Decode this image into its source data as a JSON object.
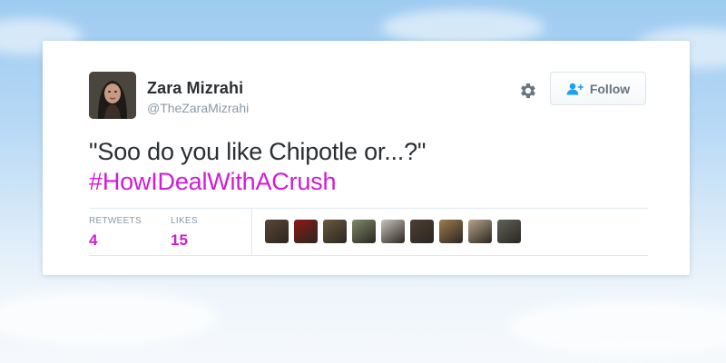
{
  "tweet": {
    "author_name": "Zara Mizrahi",
    "author_handle": "@TheZaraMizrahi",
    "text_line1": "\"Soo do you like Chipotle or...?\"",
    "hashtag": "#HowIDealWithACrush",
    "hashtag_color": "#d21bd6"
  },
  "actions": {
    "follow_label": "Follow",
    "follow_icon": "add-user-icon",
    "settings_icon": "gear-icon"
  },
  "stats": {
    "retweets_label": "RETWEETS",
    "retweets_value": "4",
    "likes_label": "LIKES",
    "likes_value": "15"
  },
  "likers": [
    {
      "color": "#5b4632"
    },
    {
      "color": "#8b1a14"
    },
    {
      "color": "#6b5a3c"
    },
    {
      "color": "#7d8a6a"
    },
    {
      "color": "#c9c4bb"
    },
    {
      "color": "#4e3f33"
    },
    {
      "color": "#a07c4e"
    },
    {
      "color": "#b7a58a"
    },
    {
      "color": "#5f6358"
    }
  ]
}
